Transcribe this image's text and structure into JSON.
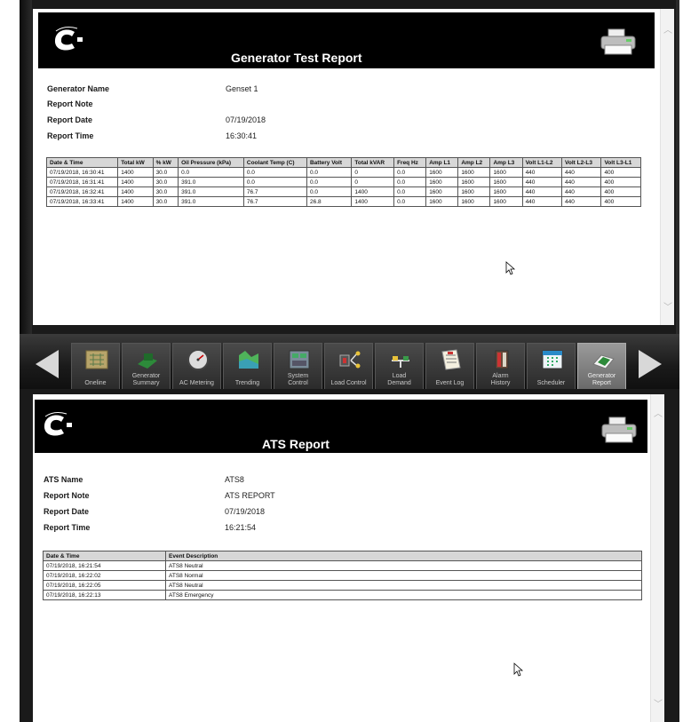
{
  "generator_report": {
    "title": "Generator Test Report",
    "fields": [
      {
        "label": "Generator Name",
        "value": "Genset 1"
      },
      {
        "label": "Report Note",
        "value": ""
      },
      {
        "label": "Report Date",
        "value": "07/19/2018"
      },
      {
        "label": "Report Time",
        "value": "16:30:41"
      }
    ],
    "columns": [
      "Date & Time",
      "Total kW",
      "% kW",
      "Oil Pressure (kPa)",
      "Coolant Temp (C)",
      "Battery Volt",
      "Total kVAR",
      "Freq Hz",
      "Amp L1",
      "Amp L2",
      "Amp L3",
      "Volt L1-L2",
      "Volt L2-L3",
      "Volt L3-L1"
    ],
    "rows": [
      [
        "07/19/2018, 16:30:41",
        "1400",
        "30.0",
        "0.0",
        "0.0",
        "0.0",
        "0",
        "0.0",
        "1600",
        "1600",
        "1600",
        "440",
        "440",
        "400"
      ],
      [
        "07/19/2018, 16:31:41",
        "1400",
        "30.0",
        "391.0",
        "0.0",
        "0.0",
        "0",
        "0.0",
        "1600",
        "1600",
        "1600",
        "440",
        "440",
        "400"
      ],
      [
        "07/19/2018, 16:32:41",
        "1400",
        "30.0",
        "391.0",
        "76.7",
        "0.0",
        "1400",
        "0.0",
        "1600",
        "1600",
        "1600",
        "440",
        "440",
        "400"
      ],
      [
        "07/19/2018, 16:33:41",
        "1400",
        "30.0",
        "391.0",
        "76.7",
        "26.8",
        "1400",
        "0.0",
        "1600",
        "1600",
        "1600",
        "440",
        "440",
        "400"
      ]
    ]
  },
  "nav": {
    "items": [
      {
        "label": "Oneline",
        "icon": "oneline-icon"
      },
      {
        "label": "Generator\nSummary",
        "icon": "generator-summary-icon"
      },
      {
        "label": "AC Metering",
        "icon": "ac-metering-icon"
      },
      {
        "label": "Trending",
        "icon": "trending-icon"
      },
      {
        "label": "System\nControl",
        "icon": "system-control-icon"
      },
      {
        "label": "Load Control",
        "icon": "load-control-icon"
      },
      {
        "label": "Load\nDemand",
        "icon": "load-demand-icon"
      },
      {
        "label": "Event Log",
        "icon": "event-log-icon"
      },
      {
        "label": "Alarm\nHistory",
        "icon": "alarm-history-icon"
      },
      {
        "label": "Scheduler",
        "icon": "scheduler-icon"
      },
      {
        "label": "Generator\nReport",
        "icon": "generator-report-icon",
        "active": true
      }
    ]
  },
  "ats_report": {
    "title": "ATS Report",
    "fields": [
      {
        "label": "ATS Name",
        "value": "ATS8"
      },
      {
        "label": "Report Note",
        "value": "ATS REPORT"
      },
      {
        "label": "Report Date",
        "value": "07/19/2018"
      },
      {
        "label": "Report Time",
        "value": "16:21:54"
      }
    ],
    "columns": [
      "Date & Time",
      "Event Description"
    ],
    "rows": [
      [
        "07/19/2018, 16:21:54",
        "ATS8 Neutral"
      ],
      [
        "07/19/2018, 16:22:02",
        "ATS8 Normal"
      ],
      [
        "07/19/2018, 16:22:05",
        "ATS8 Neutral"
      ],
      [
        "07/19/2018, 16:22:13",
        "ATS8 Emergency"
      ]
    ]
  },
  "brand": {
    "logo_text": "Cummins",
    "accent": "#000000"
  }
}
